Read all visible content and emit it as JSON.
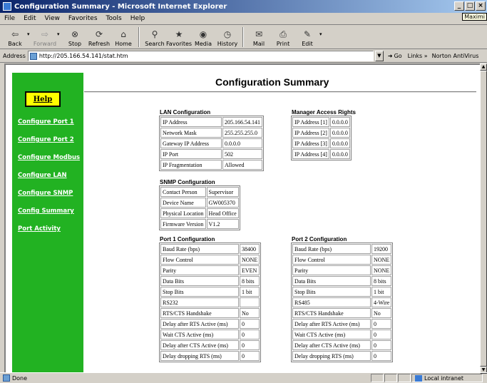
{
  "window": {
    "title": "Configuration Summary - Microsoft Internet Explorer",
    "tooltip": "Maximi",
    "min_glyph": "_",
    "max_glyph": "□",
    "close_glyph": "×"
  },
  "menu": [
    "File",
    "Edit",
    "View",
    "Favorites",
    "Tools",
    "Help"
  ],
  "toolbar": {
    "back": "Back",
    "forward": "Forward",
    "stop": "Stop",
    "refresh": "Refresh",
    "home": "Home",
    "search": "Search",
    "favorites": "Favorites",
    "media": "Media",
    "history": "History",
    "mail": "Mail",
    "print": "Print",
    "edit": "Edit"
  },
  "address": {
    "label": "Address",
    "url": "http://205.166.54.141/stat.htm",
    "go": "Go",
    "links": "Links »",
    "norton": "Norton AntiVirus"
  },
  "sidebar": {
    "help": "Help",
    "links": [
      "Configure Port 1",
      "Configure Port 2",
      "Configure Modbus",
      "Configure LAN",
      "Configure SNMP",
      "Config Summary",
      "Port Activity"
    ]
  },
  "page": {
    "title": "Configuration Summary"
  },
  "lan": {
    "title": "LAN Configuration",
    "rows": [
      [
        "IP Address",
        "205.166.54.141"
      ],
      [
        "Network Mask",
        "255.255.255.0"
      ],
      [
        "Gateway IP Address",
        "0.0.0.0"
      ],
      [
        "IP Port",
        "502"
      ],
      [
        "IP Fragmentation",
        "Allowed"
      ]
    ]
  },
  "manager": {
    "title": "Manager Access Rights",
    "rows": [
      [
        "IP Address [1]",
        "0.0.0.0"
      ],
      [
        "IP Address [2]",
        "0.0.0.0"
      ],
      [
        "IP Address [3]",
        "0.0.0.0"
      ],
      [
        "IP Address [4]",
        "0.0.0.0"
      ]
    ]
  },
  "snmp": {
    "title": "SNMP Configuration",
    "rows": [
      [
        "Contact Person",
        "Supervisor"
      ],
      [
        "Device Name",
        "GW005370"
      ],
      [
        "Physical Location",
        "Head Office"
      ],
      [
        "Firmware Version",
        "V1.2"
      ]
    ]
  },
  "port1": {
    "title": "Port 1 Configuration",
    "rows": [
      [
        "Baud Rate (bps)",
        "38400"
      ],
      [
        "Flow Control",
        "NONE"
      ],
      [
        "Parity",
        "EVEN"
      ],
      [
        "Data Bits",
        "8 bits"
      ],
      [
        "Stop Bits",
        "1 bit"
      ],
      [
        "RS232",
        ""
      ],
      [
        "RTS/CTS Handshake",
        "No"
      ],
      [
        "Delay after RTS Active (ms)",
        "0"
      ],
      [
        "Wait CTS Active (ms)",
        "0"
      ],
      [
        "Delay after CTS Active (ms)",
        "0"
      ],
      [
        "Delay dropping RTS (ms)",
        "0"
      ]
    ]
  },
  "port2": {
    "title": "Port 2 Configuration",
    "rows": [
      [
        "Baud Rate (bps)",
        "19200"
      ],
      [
        "Flow Control",
        "NONE"
      ],
      [
        "Parity",
        "NONE"
      ],
      [
        "Data Bits",
        "8 bits"
      ],
      [
        "Stop Bits",
        "1 bit"
      ],
      [
        "RS485",
        "4-Wire"
      ],
      [
        "RTS/CTS Handshake",
        "No"
      ],
      [
        "Delay after RTS Active (ms)",
        "0"
      ],
      [
        "Wait CTS Active (ms)",
        "0"
      ],
      [
        "Delay after CTS Active (ms)",
        "0"
      ],
      [
        "Delay dropping RTS (ms)",
        "0"
      ]
    ]
  },
  "status": {
    "text": "Done",
    "zone": "Local intranet"
  }
}
